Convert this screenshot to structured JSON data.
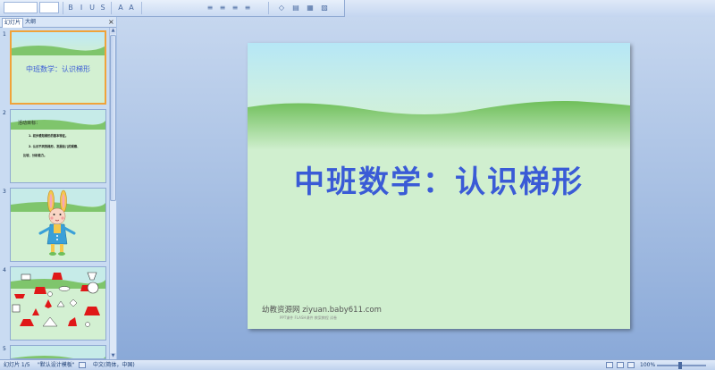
{
  "ribbon": {
    "font_combo": "",
    "size_combo": "",
    "tools": [
      "B",
      "I",
      "U",
      "S",
      "A",
      "A",
      "≡",
      "≡",
      "≡",
      "≡"
    ]
  },
  "left_panel": {
    "tabs": [
      "幻灯片",
      "大纲"
    ],
    "close_glyph": "×",
    "slides": [
      {
        "num": "1",
        "title": "中班数学：认识梯形"
      },
      {
        "num": "2",
        "heading": "活动目标：",
        "lines": [
          "1. 初步感知梯形的基本特征。",
          "2. 认识不同的梯形，发展幼儿的观察、",
          "比较、分析能力。"
        ]
      },
      {
        "num": "3"
      },
      {
        "num": "4"
      },
      {
        "num": "5"
      }
    ]
  },
  "slide": {
    "title": "中班数学：认识梯形",
    "site": "幼教资源网 ziyuan.baby611.com",
    "sub": "PPT课件  FLASH课件  教案教程  试卷"
  },
  "status": {
    "slide_index": "幻灯片 1/5",
    "theme": "\"默认设计模板\"",
    "language": "中文(简体，中国)",
    "zoom": "100%"
  },
  "colors": {
    "accent": "#3a5bd6",
    "selection": "#f0a33a",
    "grass": "#6fbf5a"
  }
}
